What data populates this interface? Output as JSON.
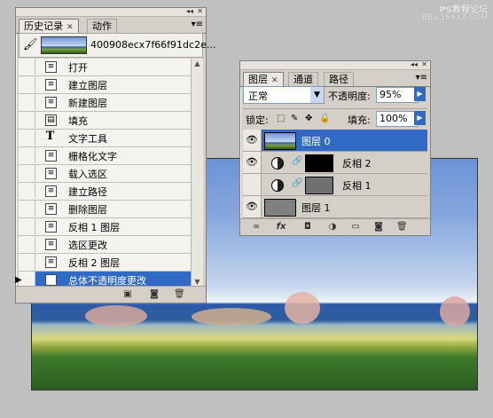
{
  "watermark": {
    "line1": "PS教程论坛",
    "line2": "BBS.16XX8.COM"
  },
  "history": {
    "tab_active": "历史记录",
    "tab_other": "动作",
    "snapshot_label": "400908ecx7f66f91dc2e...",
    "items": [
      {
        "label": "打开",
        "icon": "open-doc"
      },
      {
        "label": "建立图层",
        "icon": "doc"
      },
      {
        "label": "新建图层",
        "icon": "doc"
      },
      {
        "label": "填充",
        "icon": "fill"
      },
      {
        "label": "文字工具",
        "icon": "type-T"
      },
      {
        "label": "栅格化文字",
        "icon": "doc"
      },
      {
        "label": "载入选区",
        "icon": "doc"
      },
      {
        "label": "建立路径",
        "icon": "doc"
      },
      {
        "label": "删除图层",
        "icon": "doc"
      },
      {
        "label": "反相 1 图层",
        "icon": "doc"
      },
      {
        "label": "选区更改",
        "icon": "doc"
      },
      {
        "label": "反相 2 图层",
        "icon": "doc"
      },
      {
        "label": "总体不透明度更改",
        "icon": "doc",
        "selected": true
      }
    ]
  },
  "layers": {
    "tabs": [
      "图层",
      "通道",
      "路径"
    ],
    "blend_mode": "正常",
    "opacity_label": "不透明度:",
    "opacity_value": "95%",
    "lock_label": "锁定:",
    "fill_label": "填充:",
    "fill_value": "100%",
    "items": [
      {
        "name": "图层 0",
        "visible": true,
        "selected": true,
        "type": "image"
      },
      {
        "name": "反相 2",
        "visible": true,
        "type": "adjustment"
      },
      {
        "name": "反相 1",
        "visible": false,
        "type": "adjustment"
      },
      {
        "name": "图层 1",
        "visible": true,
        "type": "gray-fill"
      }
    ]
  },
  "colors": {
    "selection": "#316ac5",
    "panel_bg": "#d4d0c8",
    "workspace": "#c0c0c0"
  }
}
